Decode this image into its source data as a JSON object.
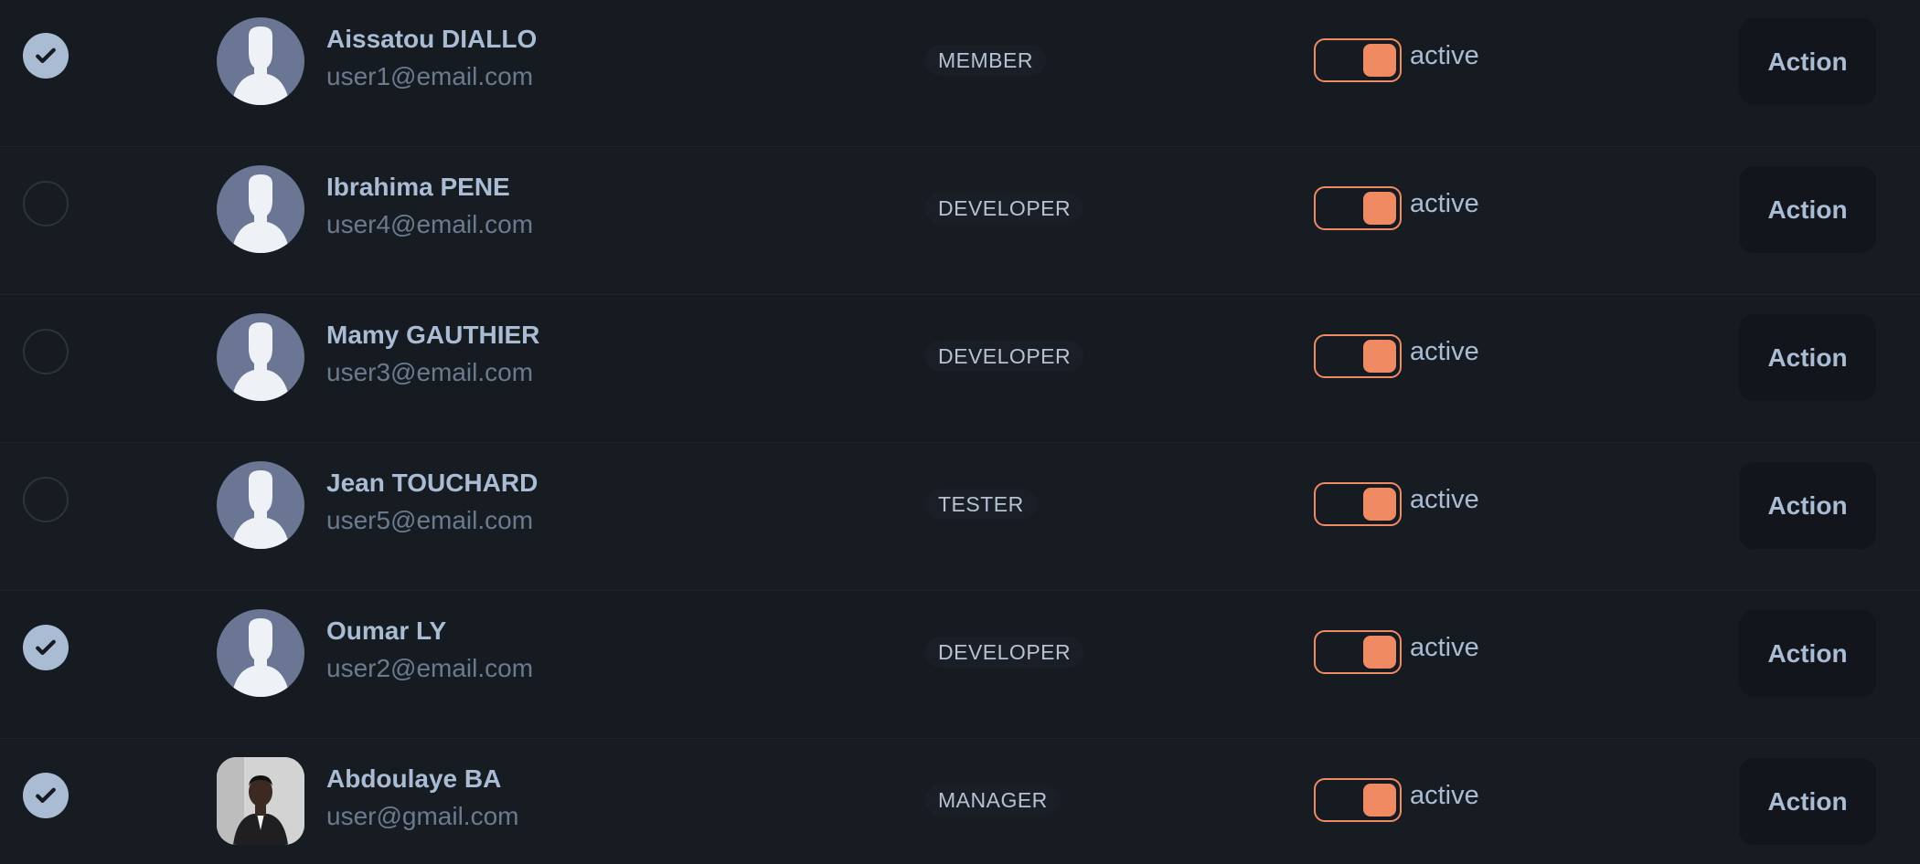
{
  "users": [
    {
      "name": "Aissatou DIALLO",
      "email": "user1@email.com",
      "role": "MEMBER",
      "status": "active",
      "selected": true,
      "avatar": "default-avatar-icon",
      "action_label": "Action"
    },
    {
      "name": "Ibrahima PENE",
      "email": "user4@email.com",
      "role": "DEVELOPER",
      "status": "active",
      "selected": false,
      "avatar": "default-avatar-icon",
      "action_label": "Action"
    },
    {
      "name": "Mamy GAUTHIER",
      "email": "user3@email.com",
      "role": "DEVELOPER",
      "status": "active",
      "selected": false,
      "avatar": "default-avatar-icon",
      "action_label": "Action"
    },
    {
      "name": "Jean TOUCHARD",
      "email": "user5@email.com",
      "role": "TESTER",
      "status": "active",
      "selected": false,
      "avatar": "default-avatar-icon",
      "action_label": "Action"
    },
    {
      "name": "Oumar LY",
      "email": "user2@email.com",
      "role": "DEVELOPER",
      "status": "active",
      "selected": true,
      "avatar": "default-avatar-icon",
      "action_label": "Action"
    },
    {
      "name": "Abdoulaye BA",
      "email": "user@gmail.com",
      "role": "MANAGER",
      "status": "active",
      "selected": true,
      "avatar": "profile-photo",
      "action_label": "Action"
    }
  ],
  "colors": {
    "accent": "#ef8a62",
    "text_primary": "#a9bcd4",
    "text_secondary": "#6b7a8e",
    "background": "#151a21"
  }
}
